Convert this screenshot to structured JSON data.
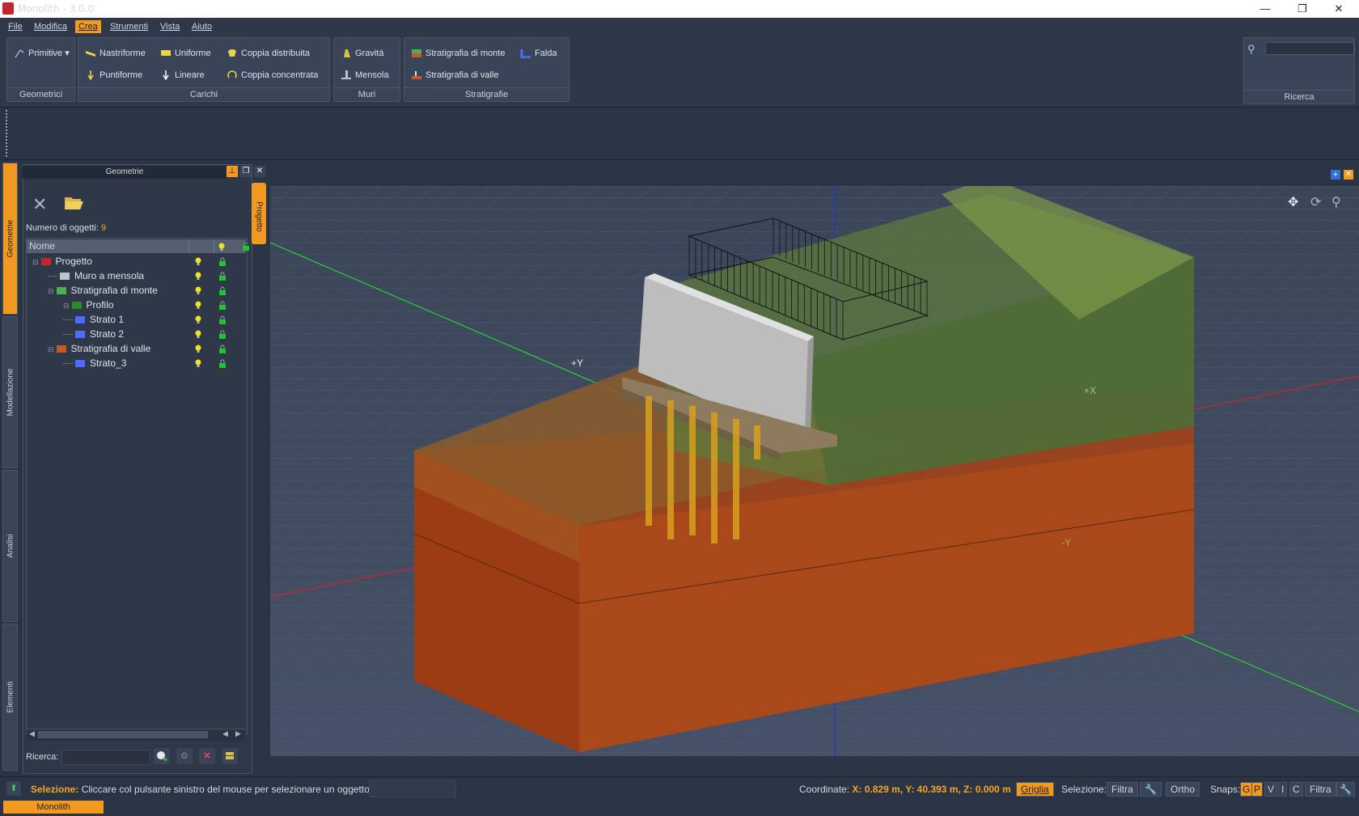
{
  "window": {
    "title": "Monolith - 3.0.0",
    "minimize": "—",
    "restore": "❐",
    "close": "✕"
  },
  "menubar": [
    "File",
    "Modifica",
    "Crea",
    "Strumenti",
    "Vista",
    "Aiuto"
  ],
  "ribbon": {
    "groups": {
      "geometrici": {
        "label": "Geometrici",
        "primitive": "Primitive"
      },
      "carichi": {
        "label": "Carichi",
        "nastriforme": "Nastriforme",
        "puntiforme": "Puntiforme",
        "uniforme": "Uniforme",
        "lineare": "Lineare",
        "coppia_distribuita": "Coppia distribuita",
        "coppia_concentrata": "Coppia concentrata"
      },
      "muri": {
        "label": "Muri",
        "gravita": "Gravità",
        "mensola": "Mensola"
      },
      "stratigrafie": {
        "label": "Stratigrafie",
        "monte": "Stratigrafia di monte",
        "valle": "Stratigrafia di valle",
        "falda": "Falda"
      },
      "ricerca": {
        "label": "Ricerca",
        "placeholder": ""
      }
    }
  },
  "left_tabs": [
    "Geometrie",
    "Modellazione",
    "Analisi",
    "Elementi"
  ],
  "panel": {
    "title": "Geometrie",
    "count_label": "Numero di oggetti:",
    "count_value": "9",
    "column_name": "Nome",
    "tree": [
      {
        "label": "Progetto",
        "depth": 0
      },
      {
        "label": "Muro a mensola",
        "depth": 1
      },
      {
        "label": "Stratigrafia di monte",
        "depth": 1
      },
      {
        "label": "Profilo",
        "depth": 2
      },
      {
        "label": "Strato 1",
        "depth": 2
      },
      {
        "label": "Strato 2",
        "depth": 2
      },
      {
        "label": "Stratigrafia di valle",
        "depth": 1
      },
      {
        "label": "Strato_3",
        "depth": 2
      }
    ],
    "search_label": "Ricerca:",
    "search_value": ""
  },
  "side_tab": "Progetto",
  "viewport": {
    "axis_labels": {
      "plus_y": "+Y",
      "plus_x": "+X",
      "minus_y": "-Y"
    }
  },
  "status": {
    "selection_label": "Selezione:",
    "selection_hint": "Cliccare col pulsante sinistro del mouse per selezionare un oggetto",
    "coord_label": "Coordinate:",
    "coord_value": "X: 0.829 m, Y: 40.393 m, Z: 0.000 m",
    "griglia": "Griglia",
    "selezione": "Selezione:",
    "filtra": "Filtra",
    "ortho": "Ortho",
    "snaps": "Snaps:",
    "snap_g": "G",
    "snap_p": "P",
    "snap_v": "V",
    "snap_i": "I",
    "snap_c": "C",
    "filtra2": "Filtra"
  },
  "bottom_tab": "Monolith",
  "colors": {
    "accent": "#f29a20",
    "background": "#2b3445",
    "panel": "#2f3849",
    "soil_upper": "#5f7a3a",
    "soil_lower": "#a8521c",
    "wall": "#c8c8c8",
    "piles": "#d9a01e"
  }
}
